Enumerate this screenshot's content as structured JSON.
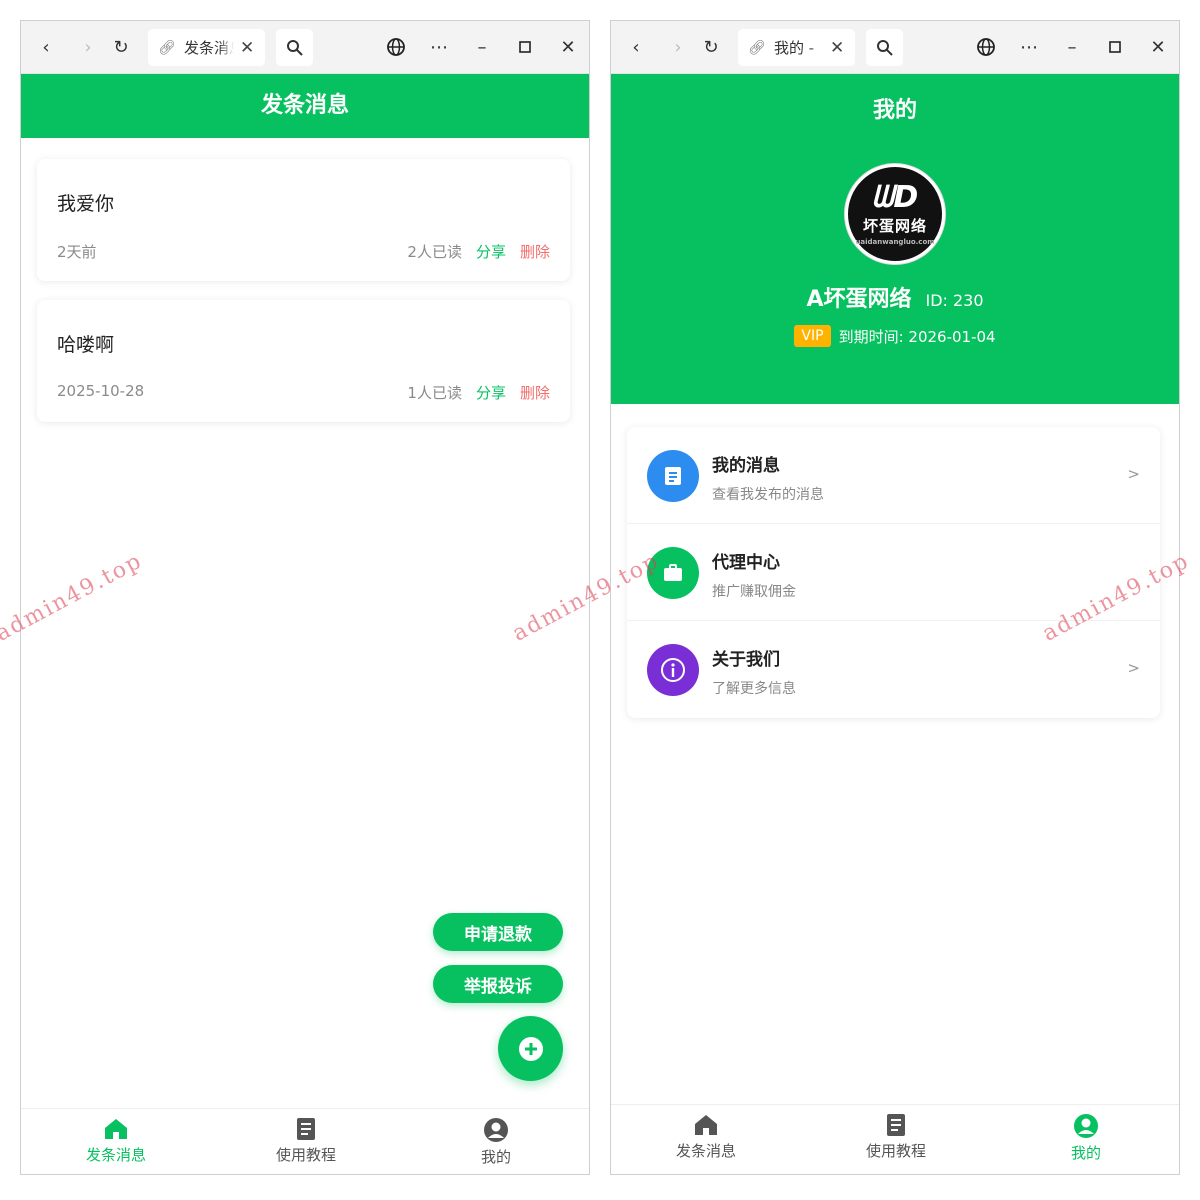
{
  "colors": {
    "brand": "#07c160",
    "danger": "#f56c6c",
    "vip": "#ffb300",
    "blue": "#2d8cf0",
    "purple": "#7a2fd6"
  },
  "left": {
    "tab_title": "发条消息",
    "header_title": "发条消息",
    "messages": [
      {
        "title": "我爱你",
        "time": "2天前",
        "read": "2人已读",
        "share": "分享",
        "delete": "删除"
      },
      {
        "title": "哈喽啊",
        "time": "2025-10-28",
        "read": "1人已读",
        "share": "分享",
        "delete": "删除"
      }
    ],
    "refund_label": "申请退款",
    "report_label": "举报投诉"
  },
  "right": {
    "tab_title": "我的 - ",
    "header_title": "我的",
    "profile": {
      "avatar_mark": "ᗯD",
      "avatar_text": "坏蛋网络",
      "avatar_sub": "uaidanwangluo.com",
      "name": "A坏蛋网络",
      "id_text": "ID: 230",
      "vip": "VIP",
      "expire": "到期时间: 2026-01-04"
    },
    "menu": [
      {
        "title": "我的消息",
        "subtitle": "查看我发布的消息",
        "arrow": ">"
      },
      {
        "title": "代理中心",
        "subtitle": "推广赚取佣金",
        "arrow": ""
      },
      {
        "title": "关于我们",
        "subtitle": "了解更多信息",
        "arrow": ">"
      }
    ]
  },
  "tabbar": [
    {
      "label": "发条消息",
      "icon": "home-icon"
    },
    {
      "label": "使用教程",
      "icon": "document-icon"
    },
    {
      "label": "我的",
      "icon": "user-icon"
    }
  ],
  "watermark": "admin49.top"
}
